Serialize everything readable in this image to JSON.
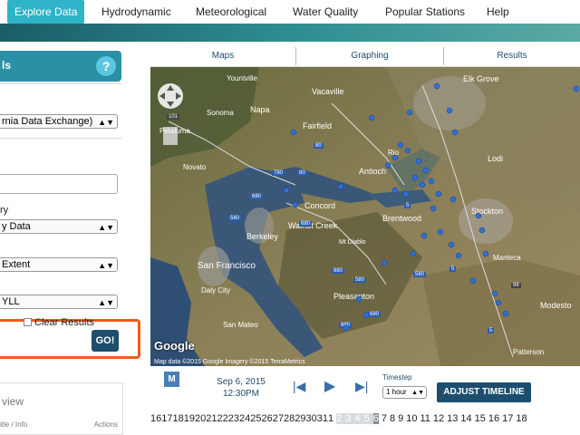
{
  "nav": {
    "items": [
      "Explore Data",
      "Hydrodynamic",
      "Meteorological",
      "Water Quality",
      "Popular Stations",
      "Help"
    ]
  },
  "left": {
    "header_title": "ls",
    "help_label": "?",
    "source_select": "rnia Data Exchange)",
    "category_label": "ry",
    "category_select": "y Data",
    "extent_select": "Extent",
    "variable_select": "YLL",
    "clear_label": "Clear Results",
    "go_label": "GO!",
    "overview_title": "view",
    "overview_col_left": "itle / Info",
    "overview_col_right": "Actions"
  },
  "tabs": [
    "Maps",
    "Graphing",
    "Results"
  ],
  "map": {
    "labels": [
      "Elk Grove",
      "Yountville",
      "Vacaville",
      "Napa",
      "Sonoma",
      "Petaluma",
      "Fairfield",
      "Rio",
      "Lodi",
      "Novato",
      "Concord",
      "Antioch",
      "Brentwood",
      "Stockton",
      "Walnut Creek",
      "Mt Diablo",
      "Berkeley",
      "San Francisco",
      "Daly City",
      "Pleasanton",
      "Manteca",
      "Modesto",
      "San Mateo",
      "Patterson"
    ],
    "road_labels": [
      "101",
      "80",
      "780",
      "680",
      "680",
      "580",
      "880",
      "5",
      "5",
      "580",
      "99",
      "580",
      "680",
      "880",
      "80",
      "5"
    ],
    "google": "Google",
    "credit": "Map data ©2015 Google Imagery ©2015 TerraMetrics"
  },
  "timeline": {
    "m_label": "M",
    "date": "Sep 6, 2015",
    "time": "12:30PM",
    "timestep_label": "Timestep",
    "timestep_value": "1 hour",
    "adjust_label": "ADJUST TIMELINE",
    "days_left": [
      "16",
      "17",
      "18",
      "19",
      "20",
      "21",
      "22",
      "23",
      "24",
      "25",
      "26",
      "27",
      "28",
      "29",
      "30",
      "31",
      "1"
    ],
    "days_range": [
      "2",
      "3",
      "4",
      "5"
    ],
    "day_selected": "6",
    "days_right": [
      "7",
      "8",
      "9",
      "10",
      "11",
      "12",
      "13",
      "14",
      "15",
      "16",
      "17",
      "18"
    ]
  },
  "colors": {
    "accent": "#2b90a6",
    "button_dark": "#1d4e6e",
    "highlight": "#ef5a1c",
    "marker": "#2f6fd6"
  }
}
